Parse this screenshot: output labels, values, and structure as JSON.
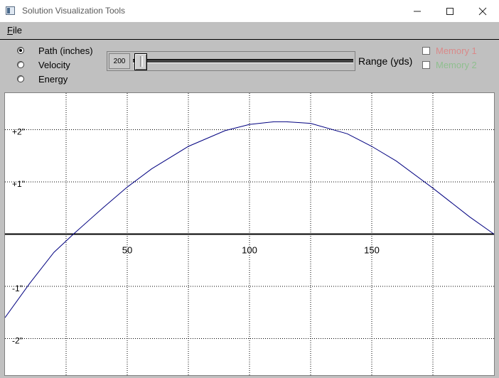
{
  "window": {
    "title": "Solution Visualization Tools",
    "controls": [
      "minimize",
      "maximize",
      "close"
    ]
  },
  "menu": {
    "file_prefix": "F",
    "file_rest": "ile"
  },
  "options": {
    "radios": [
      {
        "label": "Path (inches)",
        "checked": true
      },
      {
        "label": "Velocity",
        "checked": false
      },
      {
        "label": "Energy",
        "checked": false
      }
    ],
    "slider_value": "200",
    "range_label": "Range (yds)",
    "memory": [
      {
        "label": "Memory 1",
        "color": "#d98a8a",
        "checked": false
      },
      {
        "label": "Memory 2",
        "color": "#8fbf8f",
        "checked": false
      }
    ]
  },
  "chart_data": {
    "type": "line",
    "title": "",
    "xlabel": "",
    "ylabel": "",
    "xlim": [
      0,
      200
    ],
    "ylim": [
      -2.7,
      2.7
    ],
    "x_ticks": [
      {
        "value": 50,
        "label": "50"
      },
      {
        "value": 100,
        "label": "100"
      },
      {
        "value": 150,
        "label": "150"
      }
    ],
    "y_ticks": [
      {
        "value": 2,
        "label": "+2\""
      },
      {
        "value": 1,
        "label": "+1\""
      },
      {
        "value": -1,
        "label": "-1\""
      },
      {
        "value": -2,
        "label": "-2\""
      }
    ],
    "x_gridlines": [
      25,
      50,
      75,
      100,
      125,
      150,
      175
    ],
    "y_gridlines": [
      2,
      1,
      -1,
      -2
    ],
    "grid": true,
    "series": [
      {
        "color": "#000080",
        "x": [
          0,
          10,
          20,
          28,
          40,
          50,
          60,
          75,
          90,
          100,
          110,
          115,
          125,
          140,
          150,
          160,
          175,
          190,
          200
        ],
        "y": [
          -1.6,
          -0.95,
          -0.35,
          0.0,
          0.5,
          0.9,
          1.25,
          1.68,
          1.98,
          2.1,
          2.15,
          2.15,
          2.12,
          1.92,
          1.68,
          1.4,
          0.88,
          0.33,
          0.0
        ]
      }
    ]
  },
  "colors": {
    "panel": "#c0c0c0",
    "plot_bg": "#ffffff",
    "curve": "#000080"
  }
}
